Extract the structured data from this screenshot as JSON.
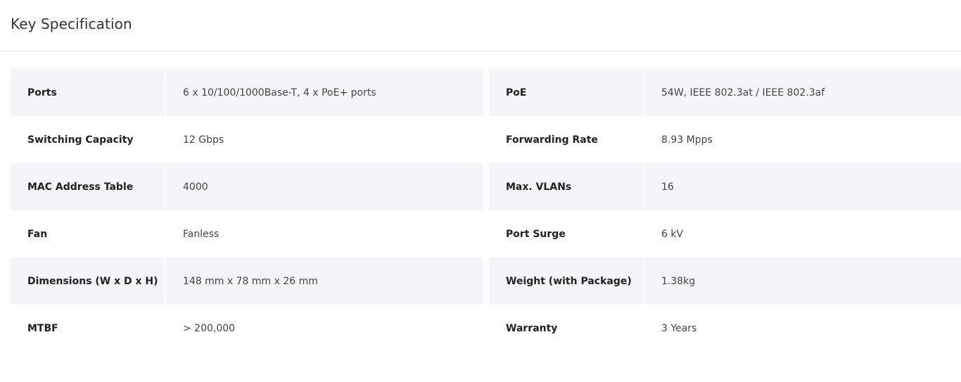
{
  "header": {
    "title": "Key Specification"
  },
  "colors": {
    "row_shade": "#f4f5f9",
    "divider": "#e4e6ea"
  },
  "specs": [
    {
      "left_label": "Ports",
      "left_value": "6 x 10/100/1000Base-T, 4 x PoE+ ports",
      "right_label": "PoE",
      "right_value": "54W, IEEE 802.3at / IEEE 802.3af"
    },
    {
      "left_label": "Switching Capacity",
      "left_value": "12 Gbps",
      "right_label": "Forwarding Rate",
      "right_value": "8.93 Mpps"
    },
    {
      "left_label": "MAC Address Table",
      "left_value": "4000",
      "right_label": "Max. VLANs",
      "right_value": "16"
    },
    {
      "left_label": "Fan",
      "left_value": "Fanless",
      "right_label": "Port Surge",
      "right_value": "6 kV"
    },
    {
      "left_label": "Dimensions (W x D x H)",
      "left_value": "148 mm x 78 mm x 26 mm",
      "right_label": "Weight (with Package)",
      "right_value": "1.38kg"
    },
    {
      "left_label": "MTBF",
      "left_value": "> 200,000",
      "right_label": "Warranty",
      "right_value": "3 Years"
    }
  ]
}
